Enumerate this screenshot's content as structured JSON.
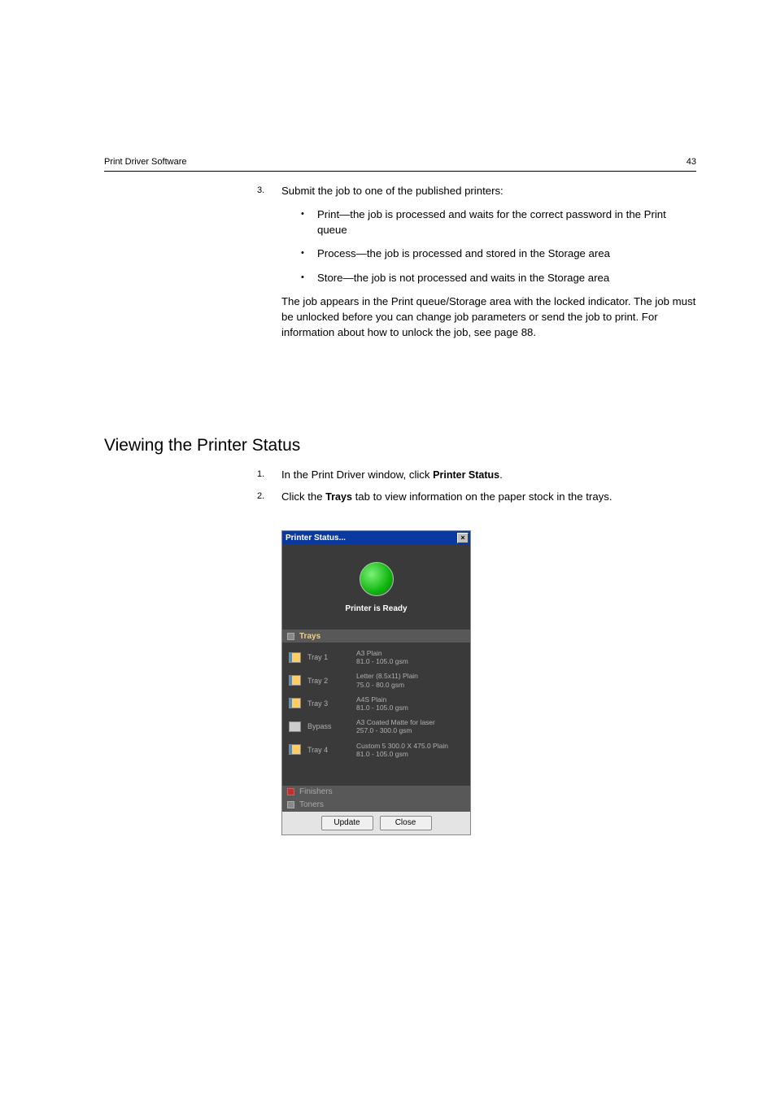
{
  "header": {
    "left": "Print Driver Software",
    "right": "43"
  },
  "step3": {
    "num": "3.",
    "text": "Submit the job to one of the published printers:",
    "bullets": [
      "Print—the job is processed and waits for the correct password in the Print queue",
      "Process—the job is processed and stored in the Storage area",
      "Store—the job is not processed and waits in the Storage area"
    ],
    "after": "The job appears in the Print queue/Storage area with the locked indicator. The job must be unlocked before you can change job parameters or send the job to print. For information about how to unlock the job, see page 88."
  },
  "section_heading": "Viewing the Printer Status",
  "steps2": [
    {
      "num": "1.",
      "pre": "In the Print Driver window, click ",
      "bold": "Printer Status",
      "post": "."
    },
    {
      "num": "2.",
      "pre": "Click the ",
      "bold": "Trays",
      "post": " tab to view information on the paper stock in the trays."
    }
  ],
  "dialog": {
    "title": "Printer Status...",
    "close": "×",
    "status": "Printer is Ready",
    "tabs": {
      "trays": "Trays",
      "finishers": "Finishers",
      "toners": "Toners"
    },
    "trays": [
      {
        "name": "Tray 1",
        "line1": "A3 Plain",
        "line2": "81.0 - 105.0 gsm",
        "empty": false
      },
      {
        "name": "Tray 2",
        "line1": "Letter (8.5x11) Plain",
        "line2": "75.0 - 80.0 gsm",
        "empty": false
      },
      {
        "name": "Tray 3",
        "line1": "A4S Plain",
        "line2": "81.0 - 105.0 gsm",
        "empty": false
      },
      {
        "name": "Bypass",
        "line1": "A3 Coated Matte for laser",
        "line2": "257.0 - 300.0 gsm",
        "empty": true
      },
      {
        "name": "Tray 4",
        "line1": "Custom 5 300.0 X 475.0 Plain",
        "line2": "81.0 - 105.0 gsm",
        "empty": false
      }
    ],
    "buttons": {
      "update": "Update",
      "close": "Close"
    }
  }
}
